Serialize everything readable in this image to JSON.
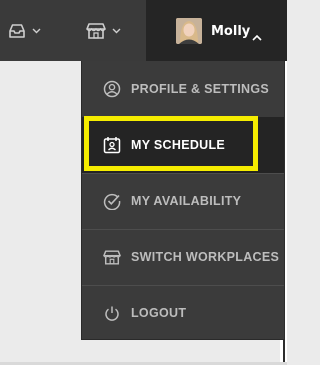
{
  "header": {
    "inbox_icon": "inbox-icon",
    "store_icon": "store-icon",
    "user": {
      "name": "Molly",
      "avatar_icon": "avatar-photo",
      "caret_icon": "chevron-up-icon"
    }
  },
  "menu": {
    "items": [
      {
        "label": "PROFILE & SETTINGS",
        "icon": "user-circle-icon",
        "active": false
      },
      {
        "label": "MY SCHEDULE",
        "icon": "schedule-badge-icon",
        "active": true
      },
      {
        "label": "MY AVAILABILITY",
        "icon": "check-circle-icon",
        "active": false
      },
      {
        "label": "SWITCH WORKPLACES",
        "icon": "store-icon",
        "active": false
      },
      {
        "label": "LOGOUT",
        "icon": "power-icon",
        "active": false
      }
    ]
  },
  "colors": {
    "header_bg": "#3a3a3a",
    "user_area_bg": "#252525",
    "menu_bg": "#3b3b3b",
    "active_bg": "#242424",
    "highlight": "#f5ec00",
    "label": "#bdbdbd"
  }
}
